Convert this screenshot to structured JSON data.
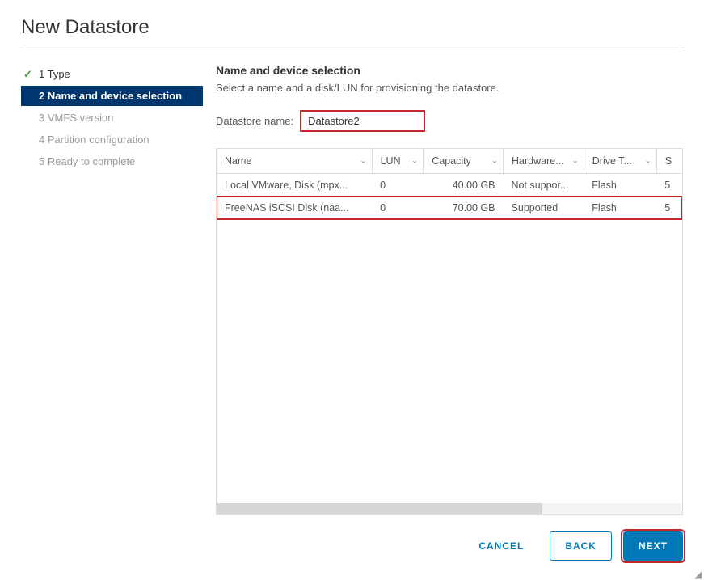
{
  "title": "New Datastore",
  "steps": [
    {
      "label": "1 Type",
      "state": "completed"
    },
    {
      "label": "2 Name and device selection",
      "state": "active"
    },
    {
      "label": "3 VMFS version",
      "state": "pending"
    },
    {
      "label": "4 Partition configuration",
      "state": "pending"
    },
    {
      "label": "5 Ready to complete",
      "state": "pending"
    }
  ],
  "section": {
    "title": "Name and device selection",
    "desc": "Select a name and a disk/LUN for provisioning the datastore."
  },
  "field": {
    "label": "Datastore name:",
    "value": "Datastore2"
  },
  "table": {
    "headers": [
      "Name",
      "LUN",
      "Capacity",
      "Hardware...",
      "Drive T...",
      "S"
    ],
    "rows": [
      {
        "name": "Local VMware, Disk (mpx...",
        "lun": "0",
        "cap": "40.00 GB",
        "hw": "Not suppor...",
        "drive": "Flash",
        "s": "5"
      },
      {
        "name": "FreeNAS iSCSI Disk (naa...",
        "lun": "0",
        "cap": "70.00 GB",
        "hw": "Supported",
        "drive": "Flash",
        "s": "5",
        "highlighted": true
      }
    ]
  },
  "buttons": {
    "cancel": "CANCEL",
    "back": "BACK",
    "next": "NEXT"
  }
}
